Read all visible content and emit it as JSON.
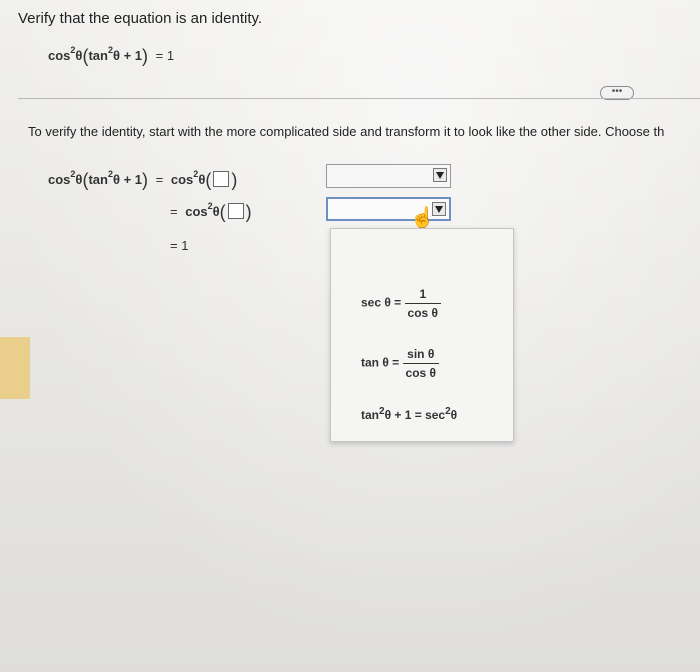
{
  "problem": {
    "title": "Verify that the equation is an identity.",
    "equation": {
      "lhs_a": "cos",
      "lhs_b": "θ",
      "lhs_c": "tan",
      "lhs_d": "θ + 1",
      "rhs": "= 1",
      "sup": "2"
    }
  },
  "more_label": "•••",
  "instructions": "To verify the identity, start with the more complicated side and transform it to look like the other side. Choose th",
  "steps": {
    "line1_left_a": "cos",
    "line1_left_b": "θ",
    "line1_left_c": "tan",
    "line1_left_d": "θ + 1",
    "eq": "=",
    "rhs_func": "cos",
    "rhs_var": "θ",
    "sup": "2",
    "final": "= 1"
  },
  "menu": {
    "options": [
      {
        "lhs": "sec θ =",
        "num": "1",
        "den": "cos θ"
      },
      {
        "lhs": "tan θ =",
        "num": "sin θ",
        "den": "cos θ"
      },
      {
        "text_a": "tan",
        "text_b": "θ + 1 = sec",
        "text_c": "θ",
        "sup": "2"
      }
    ]
  }
}
